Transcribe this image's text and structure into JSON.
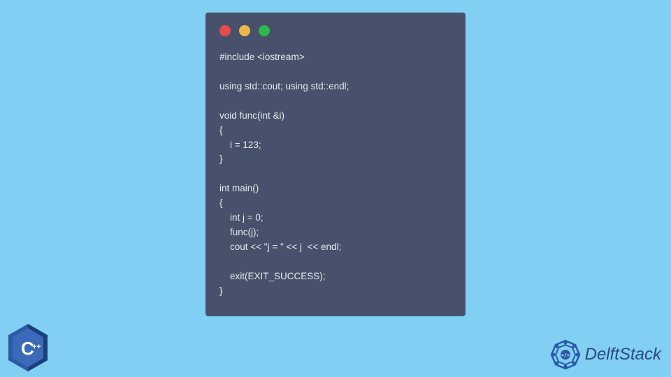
{
  "code": {
    "lines": [
      "#include <iostream>",
      "",
      "using std::cout; using std::endl;",
      "",
      "void func(int &i)",
      "{",
      "    i = 123;",
      "}",
      "",
      "int main()",
      "{",
      "    int j = 0;",
      "    func(j);",
      "    cout << \"j = \" << j  << endl;",
      "",
      "    exit(EXIT_SUCCESS);",
      "}"
    ]
  },
  "brand": {
    "name": "DelftStack"
  },
  "badge": {
    "label": "C++"
  },
  "window": {
    "controls": [
      "close",
      "minimize",
      "maximize"
    ]
  }
}
